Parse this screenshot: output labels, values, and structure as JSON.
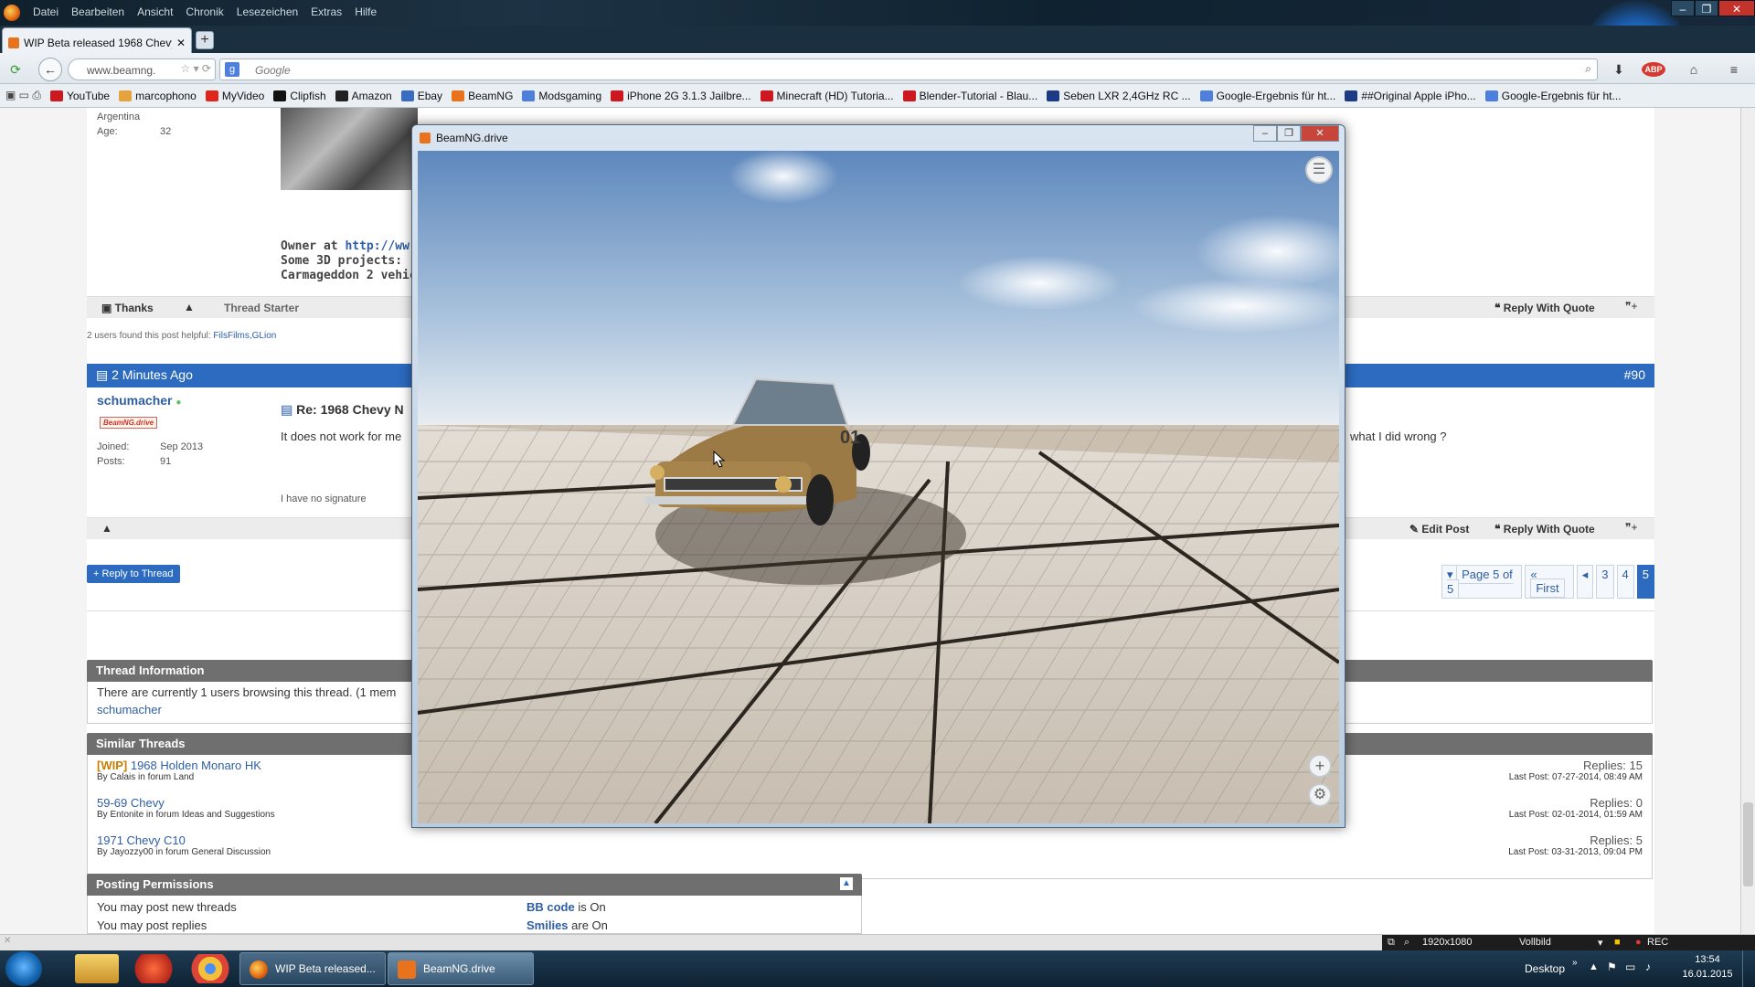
{
  "menubar": {
    "menu": [
      "Datei",
      "Bearbeiten",
      "Ansicht",
      "Chronik",
      "Lesezeichen",
      "Extras",
      "Hilfe"
    ]
  },
  "tab": {
    "title": "WIP Beta released 1968 Chevy..."
  },
  "nav": {
    "url": "www.beamng.",
    "search_placeholder": "Google",
    "search_engine_glyph": "g"
  },
  "bookmarks": [
    {
      "label": "YouTube",
      "color": "#cc181e"
    },
    {
      "label": "marcophono",
      "color": "#e6a23c"
    },
    {
      "label": "MyVideo",
      "color": "#e0261b"
    },
    {
      "label": "Clipfish",
      "color": "#111111"
    },
    {
      "label": "Amazon",
      "color": "#222222"
    },
    {
      "label": "Ebay",
      "color": "#3a6cc4"
    },
    {
      "label": "BeamNG",
      "color": "#e8731c"
    },
    {
      "label": "Modsgaming",
      "color": "#4f7fdc"
    },
    {
      "label": "iPhone 2G 3.1.3 Jailbre...",
      "color": "#cc181e"
    },
    {
      "label": "Minecraft (HD) Tutoria...",
      "color": "#cc181e"
    },
    {
      "label": "Blender-Tutorial - Blau...",
      "color": "#cc181e"
    },
    {
      "label": "Seben LXR 2,4GHz RC ...",
      "color": "#1b3b86"
    },
    {
      "label": "Google-Ergebnis für ht...",
      "color": "#4f7fdc"
    },
    {
      "label": "##Original Apple iPho...",
      "color": "#1b3b86"
    },
    {
      "label": "Google-Ergebnis für ht...",
      "color": "#4f7fdc"
    }
  ],
  "post_prev": {
    "location": "Argentina",
    "age_label": "Age:",
    "age": "32",
    "sig_owner": "Owner at",
    "sig_owner_link": "http://ww",
    "sig_3d": "Some 3D projects:",
    "sig_carma": "Carmageddon 2 vehic",
    "thanks": "Thanks",
    "thread_starter": "Thread Starter",
    "reply_quote": "Reply With Quote",
    "helpful": "2 users found this post helpful:",
    "helpful_users": "FilsFilms,GLion"
  },
  "post": {
    "date": "2 Minutes Ago",
    "number": "#90",
    "author": "schumacher",
    "badge": "BeamNG.drive",
    "joined_label": "Joined:",
    "joined": "Sep 2013",
    "posts_label": "Posts:",
    "posts": "91",
    "title": "Re: 1968 Chevy N",
    "body": "It does not work for me",
    "body_tail": "what I did wrong ?",
    "signature": "I have no signature",
    "edit": "Edit Post",
    "reply_quote": "Reply With Quote"
  },
  "reply_thread": "+ Reply to Thread",
  "pagination": {
    "label": "Page 5 of 5",
    "first": "First",
    "prev": "◂",
    "pages": [
      "3",
      "4",
      "5"
    ],
    "current": "5"
  },
  "thread_info": {
    "title": "Thread Information",
    "text": "There are currently 1 users browsing this thread. (1 mem",
    "user": "schumacher"
  },
  "similar": {
    "title": "Similar Threads",
    "threads": [
      {
        "prefix": "[WIP]",
        "title": "1968 Holden Monaro HK",
        "by": "By Calais in forum Land",
        "replies": "Replies: 15",
        "last": "Last Post: 07-27-2014, 08:49 AM"
      },
      {
        "prefix": "",
        "title": "59-69 Chevy",
        "by": "By Entonite in forum Ideas and Suggestions",
        "replies": "Replies: 0",
        "last": "Last Post: 02-01-2014, 01:59 AM"
      },
      {
        "prefix": "",
        "title": "1971 Chevy C10",
        "by": "By Jayozzy00 in forum General Discussion",
        "replies": "Replies: 5",
        "last": "Last Post: 03-31-2013, 09:04 PM"
      }
    ]
  },
  "permissions": {
    "title": "Posting Permissions",
    "rows": [
      {
        "left": "You may post new threads",
        "code": "BB code",
        "state": "is On"
      },
      {
        "left": "You may post replies",
        "code": "Smilies",
        "state": "are On"
      }
    ]
  },
  "game": {
    "title": "BeamNG.drive",
    "car_number": "01"
  },
  "recorder": {
    "resolution": "1920x1080",
    "mode": "Vollbild",
    "rec": "REC"
  },
  "taskbar": {
    "tasks": [
      "WIP Beta released...",
      "BeamNG.drive"
    ],
    "desktop": "Desktop",
    "time": "13:54",
    "date": "16.01.2015"
  }
}
